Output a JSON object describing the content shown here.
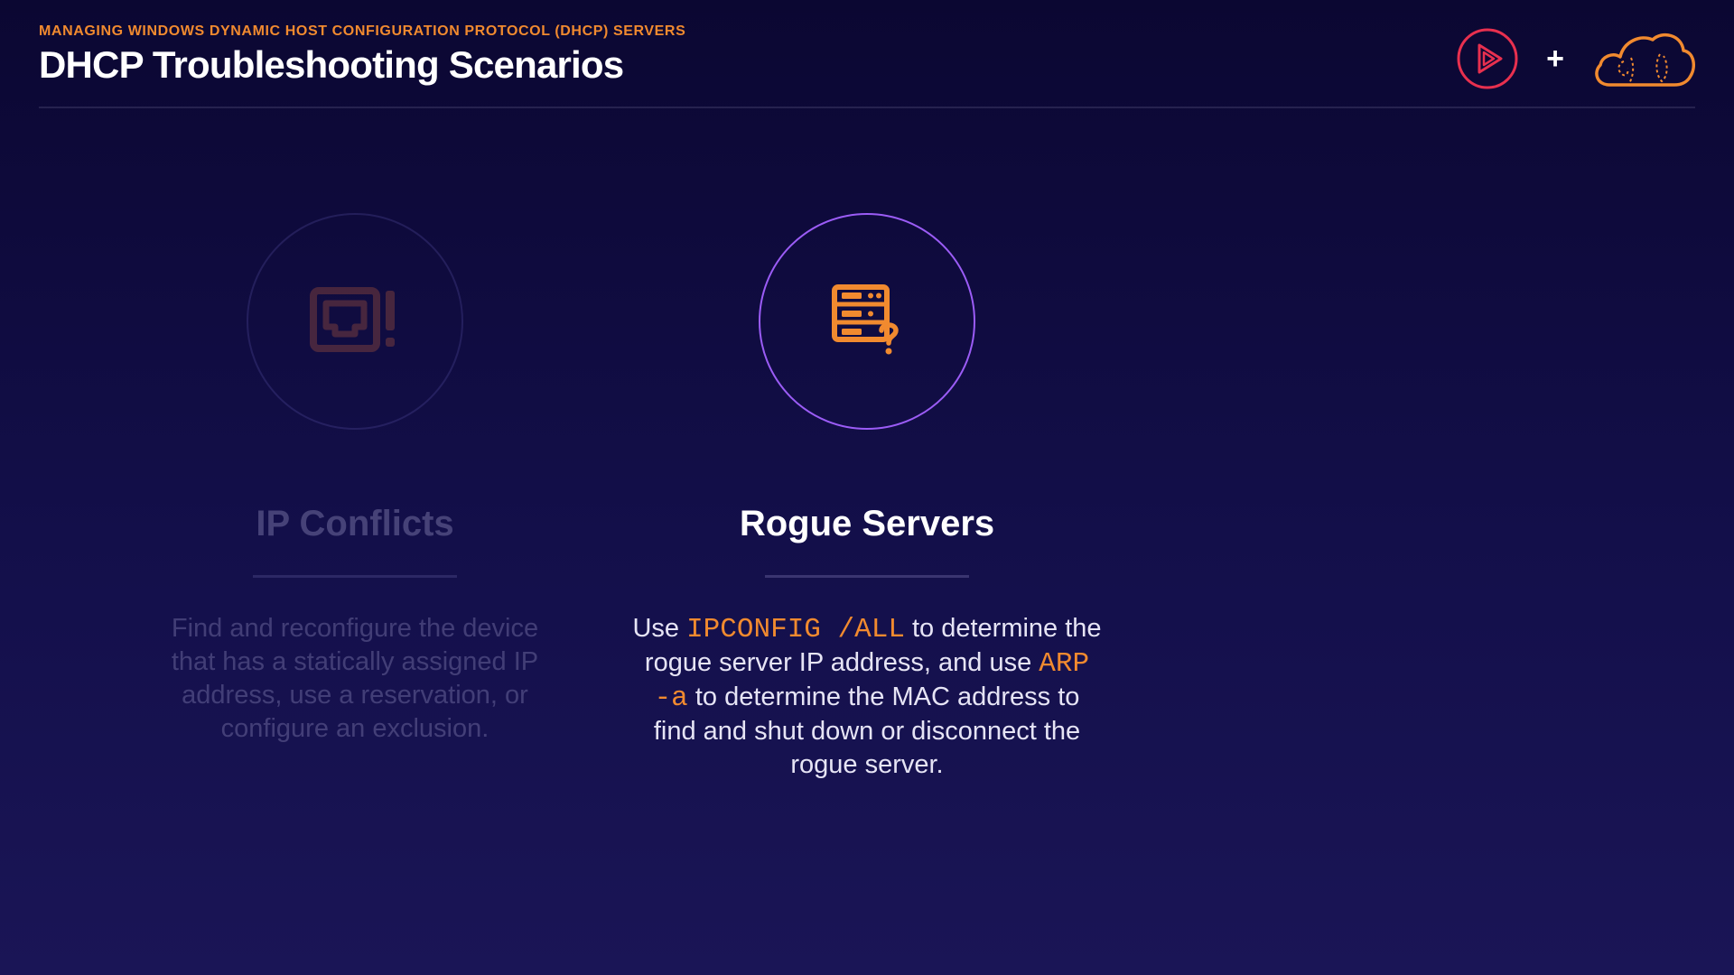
{
  "header": {
    "eyebrow": "MANAGING WINDOWS DYNAMIC HOST CONFIGURATION PROTOCOL (DHCP) SERVERS",
    "title": "DHCP Troubleshooting Scenarios",
    "plus": "+"
  },
  "logos": {
    "play_icon": "play-circle-icon",
    "cloud_icon": "cloud-icon"
  },
  "cards": [
    {
      "icon": "network-port-alert-icon",
      "title": "IP Conflicts",
      "body": "Find and reconfigure the device that has a statically assigned IP address, use a reservation, or configure an exclusion."
    },
    {
      "icon": "server-question-icon",
      "title": "Rogue Servers",
      "body_parts": [
        "Use ",
        "IPCONFIG /ALL",
        " to determine the rogue server IP address, and use ",
        "ARP -a",
        " to determine the MAC address to find and shut down or disconnect the rogue server."
      ]
    }
  ],
  "colors": {
    "accent_orange": "#f18a2f",
    "accent_purple": "#9b5cf6",
    "background_top": "#0b0732",
    "background_bottom": "#1a1556",
    "logo_red": "#e8304f"
  }
}
